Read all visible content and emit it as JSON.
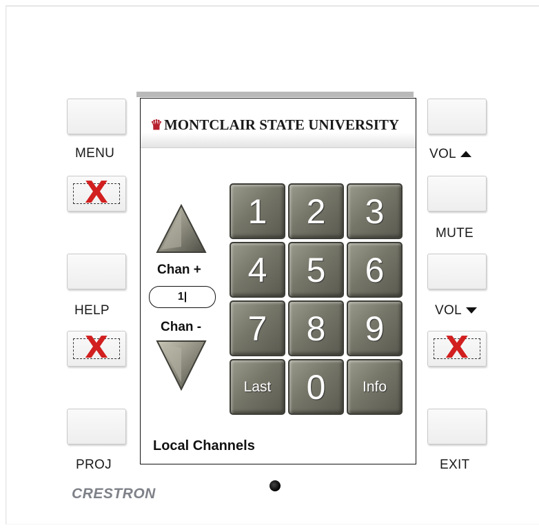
{
  "left_panel": {
    "menu_label": "MENU",
    "help_label": "HELP",
    "proj_label": "PROJ",
    "disabled_mark": "X"
  },
  "right_panel": {
    "vol_up_label": "VOL",
    "mute_label": "MUTE",
    "vol_down_label": "VOL",
    "exit_label": "EXIT"
  },
  "brand": {
    "logo": "CRESTRON"
  },
  "screen": {
    "university": "MONTCLAIR  STATE UNIVERSITY",
    "university_mark": "♣",
    "chan_up_label": "Chan +",
    "chan_down_label": "Chan -",
    "channel_value": "1|",
    "keypad": [
      "1",
      "2",
      "3",
      "4",
      "5",
      "6",
      "7",
      "8",
      "9",
      "Last",
      "0",
      "Info"
    ],
    "footer": "Local Channels"
  },
  "colors": {
    "accent_red": "#d21f1f",
    "key_gray": "#757568"
  }
}
